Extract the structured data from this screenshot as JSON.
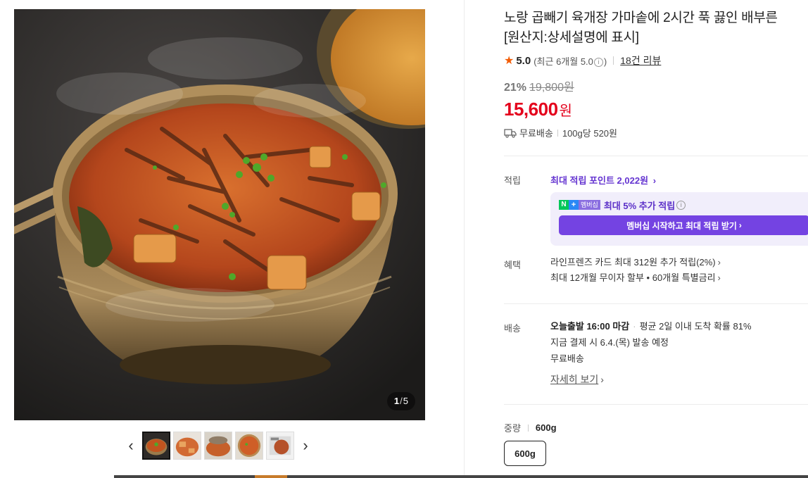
{
  "gallery": {
    "page_current": "1",
    "page_total": "5",
    "thumbnail_count": 5,
    "prev_arrow": "‹",
    "next_arrow": "›"
  },
  "product": {
    "title_line1": "노랑 곱빼기 육개장 가마솥에 2시간 푹 끓인 배부른",
    "title_line2": "[원산지:상세설명에 표시]",
    "rating": "5.0",
    "rating_recent": "(최근 6개월 5.0",
    "rating_recent_close": ")",
    "review_count": "18건 리뷰",
    "discount_rate": "21%",
    "original_price": "19,800원",
    "price": "15,600",
    "price_unit": "원",
    "shipping_free": "무료배송",
    "unit_price": "100g당 520원"
  },
  "points": {
    "label": "적립",
    "max_points": "최대 적립 포인트 2,022원",
    "membership_extra": "최대 5% 추가 적립",
    "npay_n": "N",
    "npay_plus": "+",
    "npay_text": "멤버십",
    "membership_button": "멤버십 시작하고 최대 적립 받기"
  },
  "benefits": {
    "label": "혜택",
    "card": "라인프렌즈 카드 최대 312원 추가 적립(2%)",
    "installment": "최대 12개월 무이자 할부 • 60개월 특별금리"
  },
  "delivery": {
    "label": "배송",
    "today_ship": "오늘출발 16:00 마감",
    "arrival_prob": "평균 2일 이내 도착 확률 81%",
    "ship_date": "지금 결제 시 6.4.(목) 발송 예정",
    "free": "무료배송",
    "detail_link": "자세히 보기"
  },
  "option": {
    "label": "중량",
    "selected": "600g",
    "choices": [
      "600g"
    ]
  },
  "colors": {
    "price_red": "#e4001c",
    "points_purple": "#6535d1",
    "membership_button": "#7443e2",
    "star_orange": "#f25c05"
  }
}
